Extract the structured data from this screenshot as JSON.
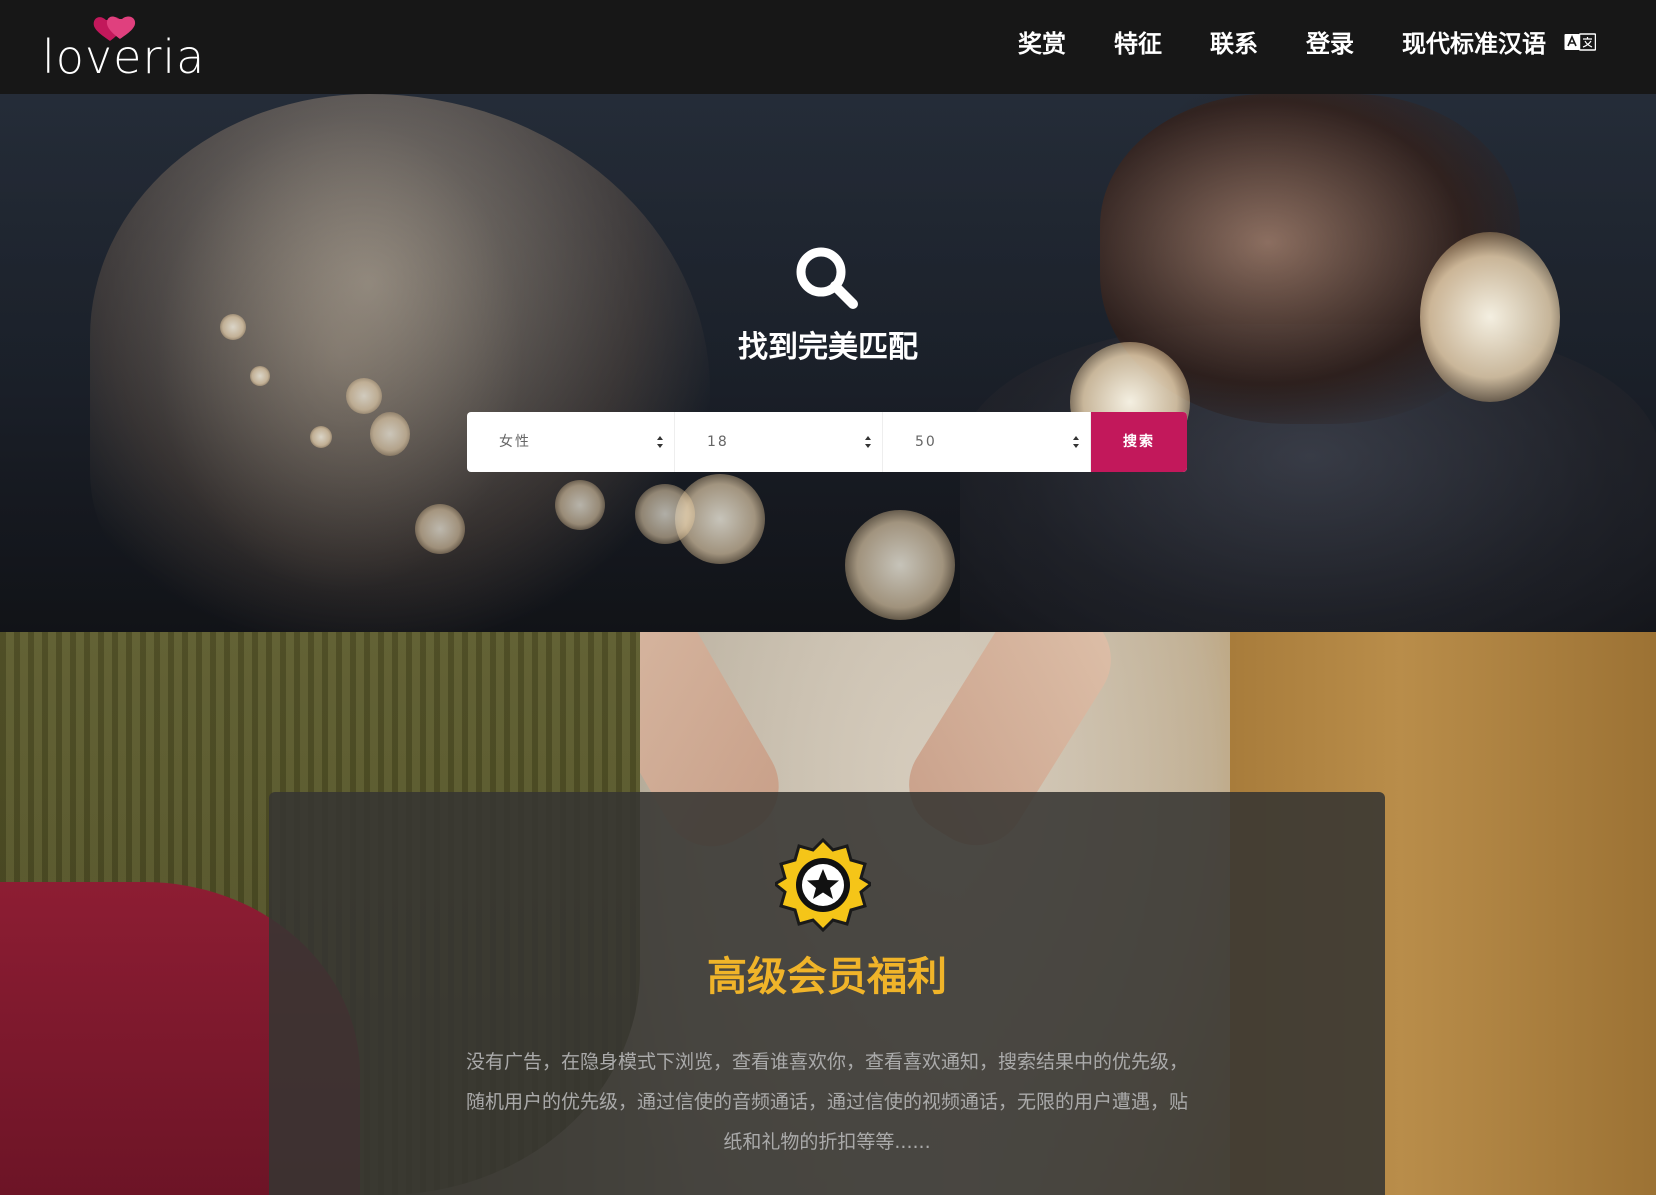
{
  "nav": {
    "logo_text": "loveria",
    "items": [
      "奖赏",
      "特征",
      "联系",
      "登录"
    ],
    "language": "现代标准汉语"
  },
  "hero": {
    "title": "找到完美匹配",
    "search": {
      "gender": "女性",
      "age_min": "18",
      "age_max": "50",
      "button": "搜索"
    }
  },
  "premium": {
    "title": "高级会员福利",
    "description": "没有广告，在隐身模式下浏览，查看谁喜欢你，查看喜欢通知，搜索结果中的优先级，随机用户的优先级，通过信使的音频通话，通过信使的视频通话，无限的用户遭遇，贴纸和礼物的折扣等等......"
  },
  "colors": {
    "brand": "#c2185b",
    "title_accent": "#f0b429"
  }
}
